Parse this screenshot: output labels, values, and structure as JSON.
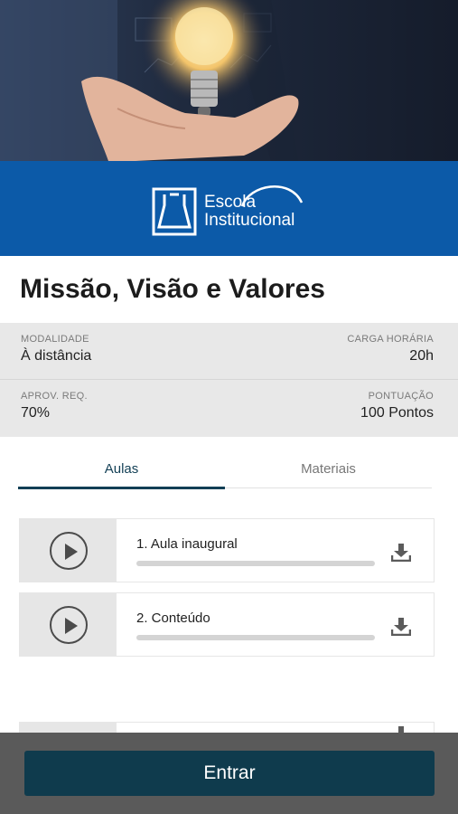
{
  "banner": {
    "brand_line1": "Escola",
    "brand_line2": "Institucional"
  },
  "course": {
    "title": "Missão, Visão e Valores"
  },
  "info": {
    "modalidade": {
      "label": "MODALIDADE",
      "value": "À distância"
    },
    "carga": {
      "label": "CARGA HORÁRIA",
      "value": "20h"
    },
    "aprov": {
      "label": "APROV. REQ.",
      "value": "70%"
    },
    "pontuacao": {
      "label": "PONTUAÇÃO",
      "value": "100 Pontos"
    }
  },
  "tabs": [
    {
      "label": "Aulas",
      "active": true
    },
    {
      "label": "Materiais",
      "active": false
    }
  ],
  "lessons": [
    {
      "title": "1. Aula inaugural",
      "progress": 0
    },
    {
      "title": "2. Conteúdo",
      "progress": 0
    },
    {
      "title": "",
      "progress": 0
    }
  ],
  "icons": {
    "play": "play-icon",
    "download": "download-icon"
  },
  "colors": {
    "brand_blue": "#0c5aa8",
    "primary_dark": "#123f55",
    "button": "#0f3b4d"
  },
  "footer": {
    "enter_label": "Entrar"
  }
}
